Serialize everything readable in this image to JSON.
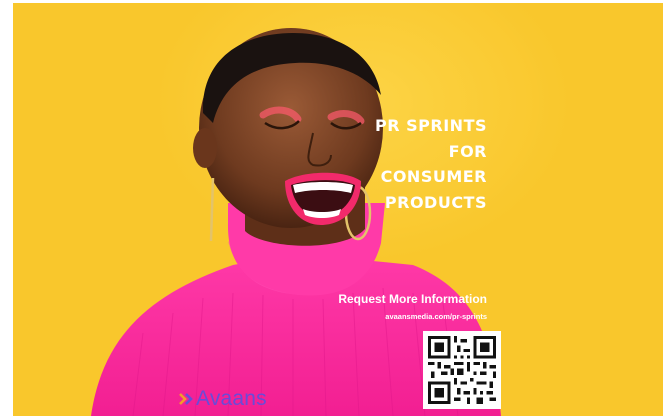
{
  "poster": {
    "background_color": "#f9c72c",
    "accent_color": "#ff2fa0",
    "headline_lines": [
      "PR SPRINTS",
      "FOR",
      "CONSUMER",
      "PRODUCTS"
    ],
    "cta_title": "Request More Information",
    "cta_url": "avaansmedia.com/pr-sprints",
    "qr_code": "qr-code-icon",
    "photo": "laughing-woman-photo"
  },
  "logo": {
    "wordmark": "Avaans",
    "icon": "double-chevron-icon",
    "color": "#6a4bd8"
  }
}
